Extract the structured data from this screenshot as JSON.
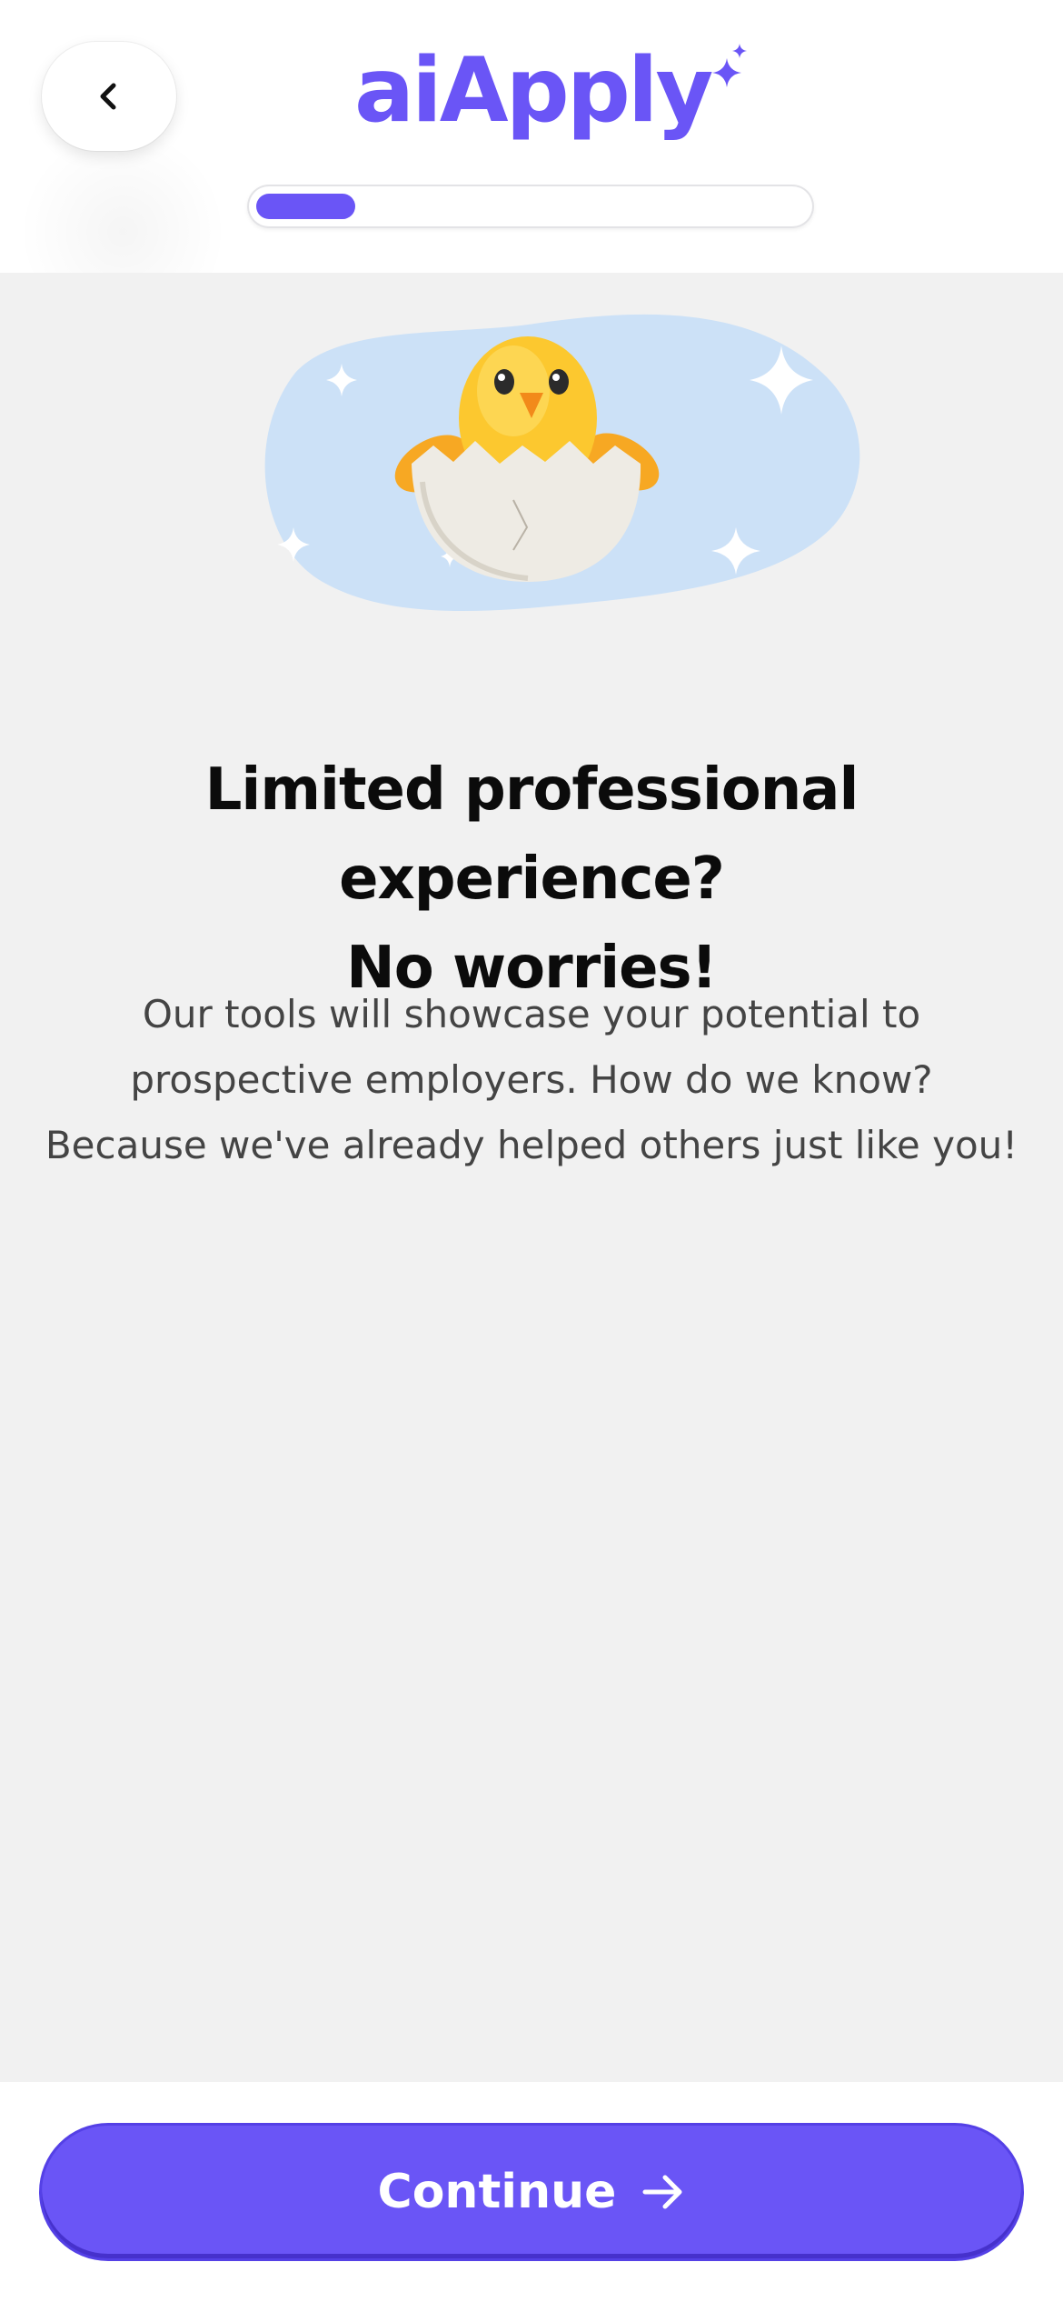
{
  "header": {
    "logo": "aiApply",
    "progress_fraction": 0.18
  },
  "content": {
    "headline_line1": "Limited professional experience?",
    "headline_line2": "No worries!",
    "body_line1": "Our tools will showcase your potential to",
    "body_line2": "prospective employers. How do we know?",
    "body_line3": "Because we've already helped others just like you!"
  },
  "footer": {
    "continue_label": "Continue"
  },
  "icons": {
    "back": "chevron-left-icon",
    "continue": "arrow-right-icon",
    "logo_sparkle": "sparkle-icon",
    "hero": "hatching-chick-emoji"
  },
  "colors": {
    "brand": "#6a55f6",
    "background": "#f1f1f1",
    "hero_blob": "#cce1f7"
  }
}
